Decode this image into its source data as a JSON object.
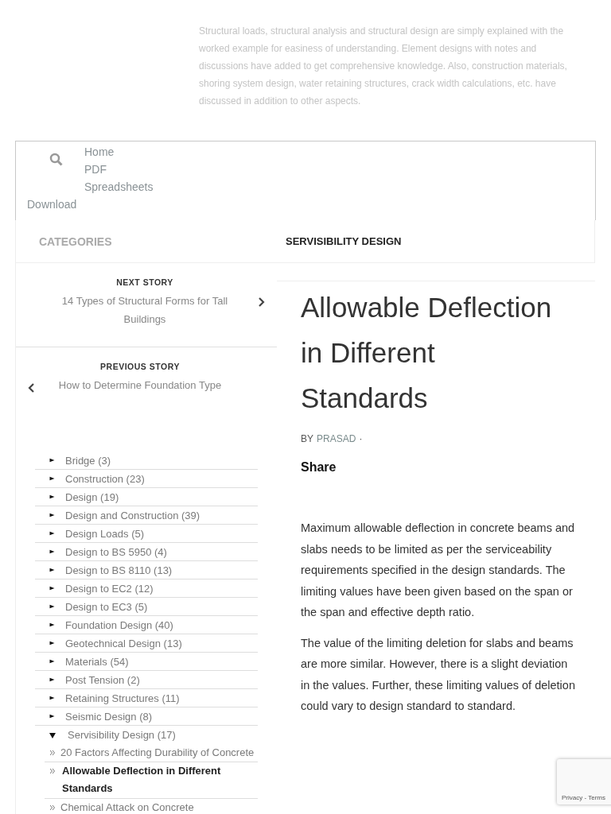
{
  "intro": "Structural loads, structural analysis and structural design are simply explained with the worked example for easiness of understanding. Element designs with notes and discussions have added to get comprehensive knowledge. Also, construction materials, shoring system design, water retaining structures, crack width calculations, etc. have discussed in addition to other aspects.",
  "menu": {
    "primary": [
      "Home",
      "PDF",
      "Spreadsheets"
    ],
    "secondary": [
      "Download"
    ]
  },
  "sidebar_tab": "CATEGORIES",
  "section_tab": "SERVISIBILITY DESIGN",
  "next_story": {
    "label": "NEXT STORY",
    "title": "14 Types of Structural Forms for Tall Buildings"
  },
  "previous_story": {
    "label": "PREVIOUS STORY",
    "title": "How to Determine Foundation Type"
  },
  "categories": [
    {
      "name": "Bridge",
      "count": "(3)",
      "expanded": false
    },
    {
      "name": "Construction",
      "count": "(23)",
      "expanded": false
    },
    {
      "name": "Design",
      "count": "(19)",
      "expanded": false
    },
    {
      "name": "Design and Construction",
      "count": "(39)",
      "expanded": false
    },
    {
      "name": "Design Loads",
      "count": "(5)",
      "expanded": false
    },
    {
      "name": "Design to BS 5950",
      "count": "(4)",
      "expanded": false
    },
    {
      "name": "Design to BS 8110",
      "count": "(13)",
      "expanded": false
    },
    {
      "name": "Design to EC2",
      "count": "(12)",
      "expanded": false
    },
    {
      "name": "Design to EC3",
      "count": "(5)",
      "expanded": false
    },
    {
      "name": "Foundation Design",
      "count": "(40)",
      "expanded": false
    },
    {
      "name": "Geotechnical Design",
      "count": "(13)",
      "expanded": false
    },
    {
      "name": "Materials",
      "count": "(54)",
      "expanded": false
    },
    {
      "name": "Post Tension",
      "count": "(2)",
      "expanded": false
    },
    {
      "name": "Retaining Structures",
      "count": "(11)",
      "expanded": false
    },
    {
      "name": "Seismic Design",
      "count": "(8)",
      "expanded": false
    },
    {
      "name": "Servisibility Design",
      "count": "(17)",
      "expanded": true,
      "children": [
        {
          "name": "20 Factors Affecting Durability of Concrete",
          "selected": false
        },
        {
          "name": "Allowable Deflection in Different Standards",
          "selected": true
        },
        {
          "name": "Chemical Attack on Concrete",
          "selected": false
        }
      ]
    }
  ],
  "article": {
    "title": "Allowable Deflection in Different Standards",
    "by": "BY",
    "author": "PRASAD",
    "separator": "·",
    "share": "Share",
    "paragraphs": [
      "Maximum allowable deflection in concrete beams and slabs needs to be limited as per the serviceability requirements specified in the design standards. The limiting values have been given based on the span or the span and effective depth ratio.",
      "The value of the limiting deletion for slabs and beams are more similar. However, there is a slight deviation in the values. Further, these limiting values of deletion could vary to design standard to standard."
    ]
  },
  "recaptcha": {
    "links": "Privacy - Terms"
  }
}
